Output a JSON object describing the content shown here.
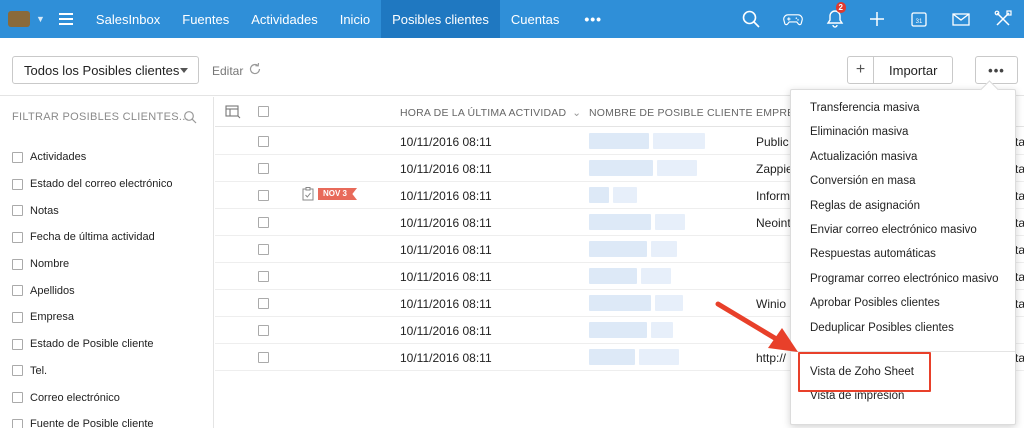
{
  "nav": {
    "items": [
      {
        "label": "SalesInbox",
        "active": false
      },
      {
        "label": "Fuentes",
        "active": false
      },
      {
        "label": "Actividades",
        "active": false
      },
      {
        "label": "Inicio",
        "active": false
      },
      {
        "label": "Posibles clientes",
        "active": true
      },
      {
        "label": "Cuentas",
        "active": false
      }
    ],
    "more_label": "•••",
    "notification_count": "2",
    "calendar_day": "31",
    "icons": [
      "search-icon",
      "gamepad-icon",
      "bell-icon",
      "plus-icon",
      "calendar-icon",
      "mail-icon",
      "tools-icon"
    ],
    "accent": "#2f8fd8"
  },
  "toolbar": {
    "view_label": "Todos los Posibles clientes",
    "edit_label": "Editar",
    "import_plus": "+",
    "import_label": "Importar",
    "more_label": "•••"
  },
  "sidebar": {
    "filter_heading": "FILTRAR POSIBLES CLIENTES...",
    "filters": [
      "Actividades",
      "Estado del correo electrónico",
      "Notas",
      "Fecha de última actividad",
      "Nombre",
      "Apellidos",
      "Empresa",
      "Estado de Posible cliente",
      "Tel.",
      "Correo electrónico",
      "Fuente de Posible cliente"
    ]
  },
  "table": {
    "headers": {
      "last_activity": "HORA DE LA ÚLTIMA ACTIVIDAD",
      "lead_name": "NOMBRE DE POSIBLE CLIENTE",
      "company": "EMPRE"
    },
    "rows": [
      {
        "time": "10/11/2016 08:11",
        "company": "Public",
        "tag": "",
        "edge": "ta"
      },
      {
        "time": "10/11/2016 08:11",
        "company": "Zappie",
        "tag": "",
        "edge": "ta"
      },
      {
        "time": "10/11/2016 08:11",
        "company": "Inform",
        "tag": "NOV 3",
        "edge": "ta"
      },
      {
        "time": "10/11/2016 08:11",
        "company": "Neoint",
        "tag": "",
        "edge": "ta"
      },
      {
        "time": "10/11/2016 08:11",
        "company": "",
        "tag": "",
        "edge": "ta"
      },
      {
        "time": "10/11/2016 08:11",
        "company": "",
        "tag": "",
        "edge": "ta"
      },
      {
        "time": "10/11/2016 08:11",
        "company": "Winio",
        "tag": "",
        "edge": "ta"
      },
      {
        "time": "10/11/2016 08:11",
        "company": "",
        "tag": "",
        "edge": ""
      },
      {
        "time": "10/11/2016 08:11",
        "company": "http://",
        "tag": "",
        "edge": "ta"
      }
    ]
  },
  "dropdown": {
    "items": [
      "Transferencia masiva",
      "Eliminación masiva",
      "Actualización masiva",
      "Conversión en masa",
      "Reglas de asignación",
      "Enviar correo electrónico masivo",
      "Respuestas automáticas",
      "Programar correo electrónico masivo",
      "Aprobar Posibles clientes",
      "Deduplicar Posibles clientes"
    ],
    "secondary_items": [
      "Vista de Zoho Sheet",
      "Vista de impresión"
    ],
    "highlighted": "Vista de Zoho Sheet",
    "highlight_color": "#e8402a"
  }
}
